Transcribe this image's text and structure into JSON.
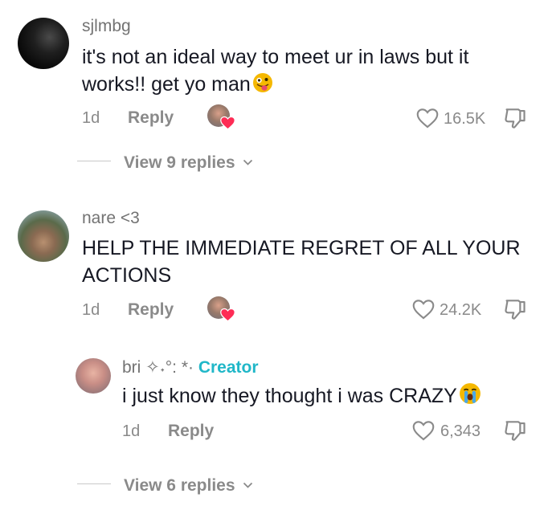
{
  "comments": [
    {
      "username": "sjlmbg",
      "text": "it's not an ideal way to meet ur in laws but it works!! get yo man",
      "emoji_icon": "zany-face-emoji",
      "time": "1d",
      "reply_label": "Reply",
      "likes": "16.5K"
    },
    {
      "username": "nare <3",
      "text": "HELP THE IMMEDIATE REGRET OF ALL YOUR ACTIONS",
      "time": "1d",
      "reply_label": "Reply",
      "likes": "24.2K"
    }
  ],
  "reply": {
    "username": "bri ✧˖°: *·",
    "creator_badge": "Creator",
    "text": "i just know they thought i was CRAZY",
    "emoji_icon": "loudly-crying-face-emoji",
    "time": "1d",
    "reply_label": "Reply",
    "likes": "6,343"
  },
  "view_replies": [
    {
      "label": "View 9 replies"
    },
    {
      "label": "View 6 replies"
    }
  ],
  "colors": {
    "creator": "#20b7c8",
    "heart": "#fe2c55",
    "muted": "#8a8a8a"
  }
}
